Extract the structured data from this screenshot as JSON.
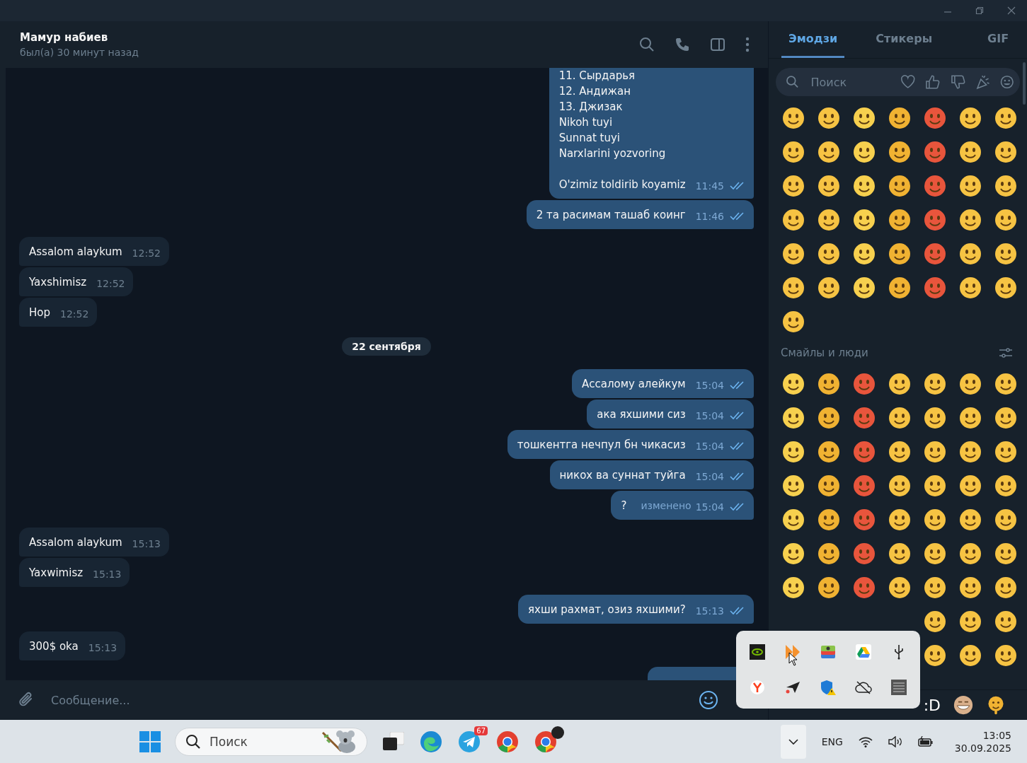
{
  "chat_header": {
    "name": "Мамур набиев",
    "status": "был(а) 30 минут назад"
  },
  "messages": [
    {
      "kind": "outgoing",
      "text": "11. Сырдарья\n12. Андижан\n13. Джизак\nNikoh tuyi\nSunnat tuyi\nNarxlarini yozvoring\n\nO'zimiz toldirib koyamiz",
      "time": "11:45",
      "read": true
    },
    {
      "kind": "outgoing",
      "text": "2 та расимам ташаб коинг",
      "time": "11:46",
      "read": true
    },
    {
      "kind": "incoming",
      "text": "Assalom alaykum",
      "time": "12:52"
    },
    {
      "kind": "incoming",
      "text": "Yaxshimisz",
      "time": "12:52"
    },
    {
      "kind": "incoming",
      "text": "Hop",
      "time": "12:52"
    },
    {
      "kind": "date",
      "text": "22 сентября"
    },
    {
      "kind": "outgoing",
      "text": "Ассалому алейкум",
      "time": "15:04",
      "read": true
    },
    {
      "kind": "outgoing",
      "text": "ака яхшими сиз",
      "time": "15:04",
      "read": true
    },
    {
      "kind": "outgoing",
      "text": "тошкентга нечпул бн чикасиз",
      "time": "15:04",
      "read": true
    },
    {
      "kind": "outgoing",
      "text": "никох ва суннат туйга",
      "time": "15:04",
      "read": true
    },
    {
      "kind": "outgoing",
      "text": "?",
      "edited_label": "изменено",
      "time": "15:04",
      "read": true
    },
    {
      "kind": "incoming",
      "text": "Assalom alaykum",
      "time": "15:13"
    },
    {
      "kind": "incoming",
      "text": "Yaxwimisz",
      "time": "15:13"
    },
    {
      "kind": "outgoing",
      "text": "яхши рахмат, озиз яхшими?",
      "time": "15:13",
      "read": true
    },
    {
      "kind": "incoming",
      "text": "300$ oka",
      "time": "15:13"
    },
    {
      "kind": "partial"
    }
  ],
  "composer": {
    "placeholder": "Сообщение..."
  },
  "emoji_panel": {
    "tabs": [
      {
        "label": "Эмодзи",
        "selected": true
      },
      {
        "label": "Стикеры",
        "selected": false
      },
      {
        "label": "GIF",
        "selected": false
      }
    ],
    "search": {
      "placeholder": "Поиск"
    },
    "section_title": "Смайлы и люди",
    "bottom_text": ":D"
  },
  "taskbar": {
    "search": {
      "placeholder": "Поиск"
    },
    "telegram_badge": "67",
    "language": "ENG",
    "time": "13:05",
    "date": "30.09.2025"
  }
}
